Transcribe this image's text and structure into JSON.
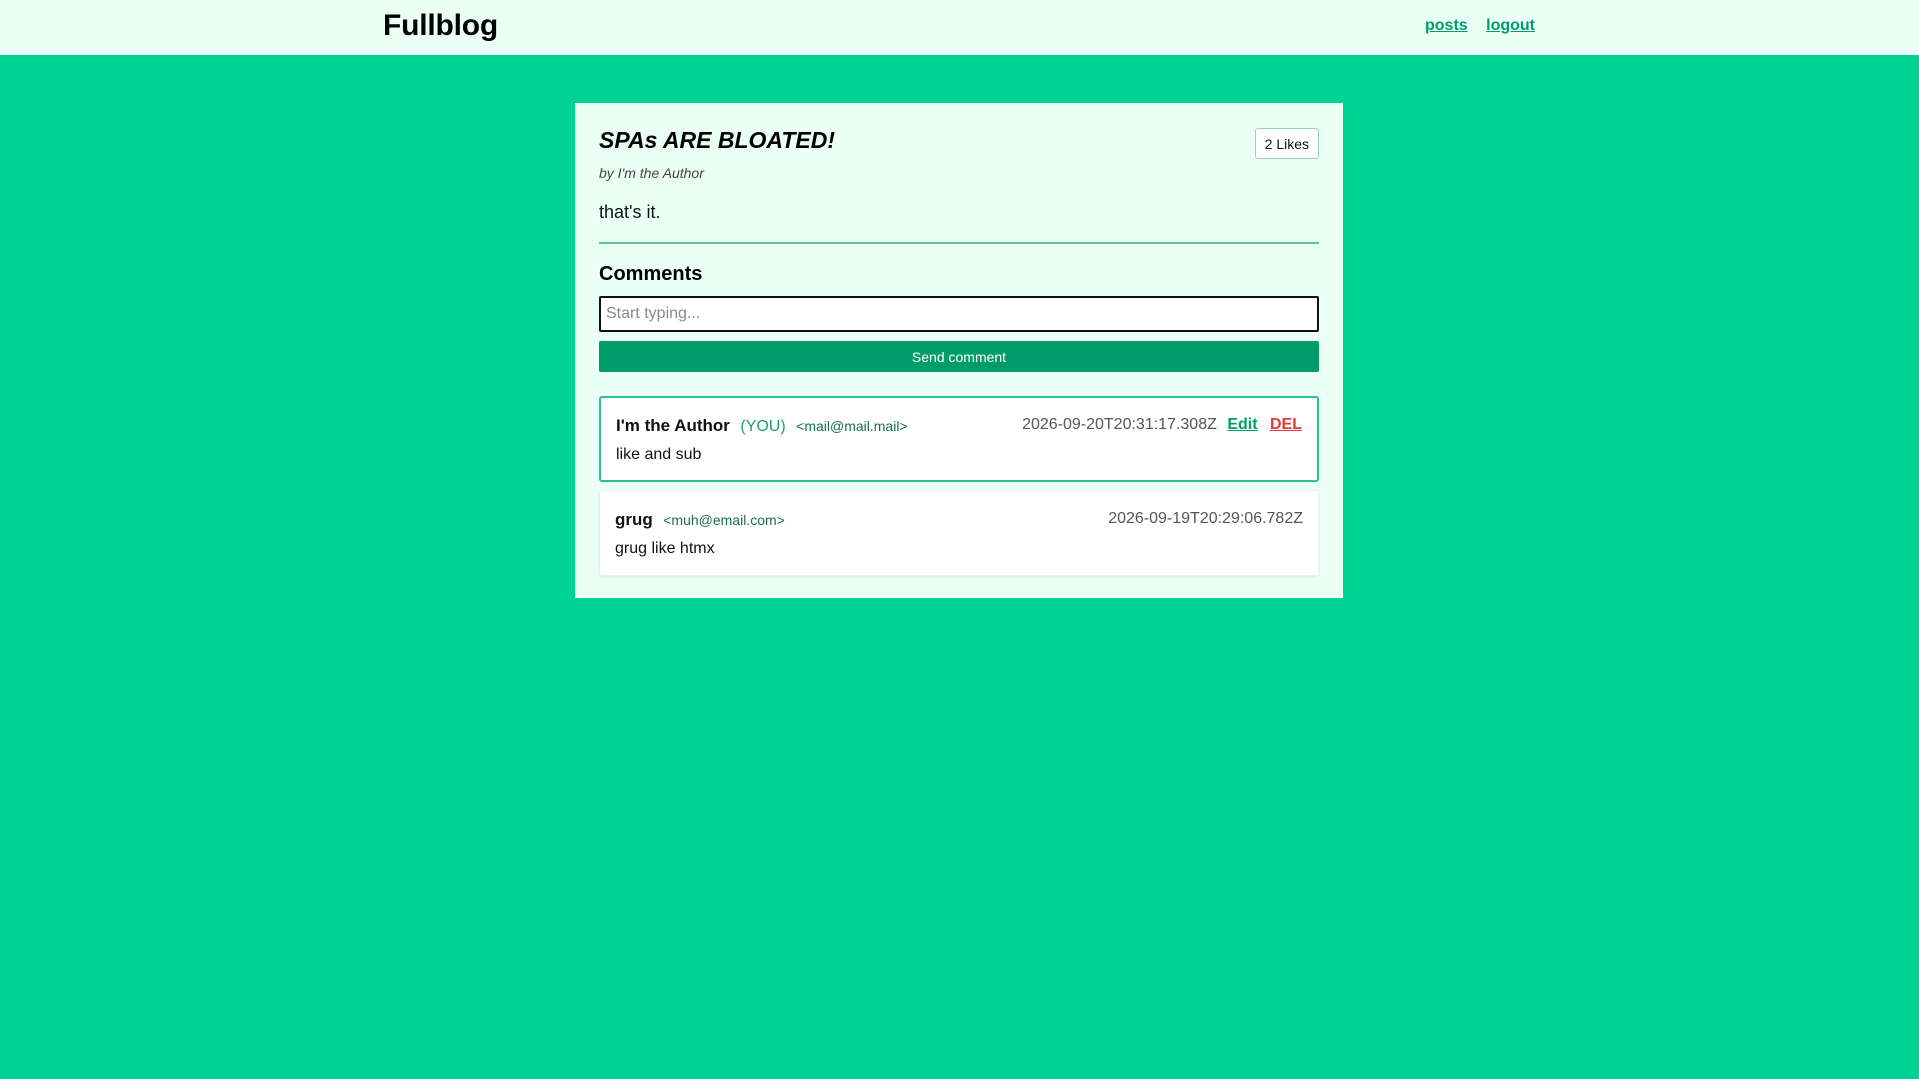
{
  "header": {
    "brand": "Fullblog",
    "nav": [
      {
        "label": "posts"
      },
      {
        "label": "logout"
      }
    ]
  },
  "post": {
    "title": "SPAs ARE BLOATED!",
    "likes_label": "2 Likes",
    "byline": "by I'm the Author",
    "body": "that's it."
  },
  "comments_section": {
    "heading": "Comments",
    "input_placeholder": "Start typing...",
    "input_value": "",
    "send_label": "Send comment"
  },
  "comments": [
    {
      "author": "I'm the Author",
      "you_tag": "(YOU)",
      "email": "<mail@mail.mail>",
      "date": "2026-09-20T20:31:17.308Z",
      "edit_label": "Edit",
      "delete_label": "DEL",
      "text": "like and sub"
    },
    {
      "author": "grug",
      "email": "<muh@email.com>",
      "date": "2026-09-19T20:29:06.782Z",
      "text": "grug like htmx"
    }
  ],
  "colors": {
    "background": "#00d393",
    "surface": "#eafff5",
    "accent": "#009c69",
    "danger": "#e23a3a"
  }
}
